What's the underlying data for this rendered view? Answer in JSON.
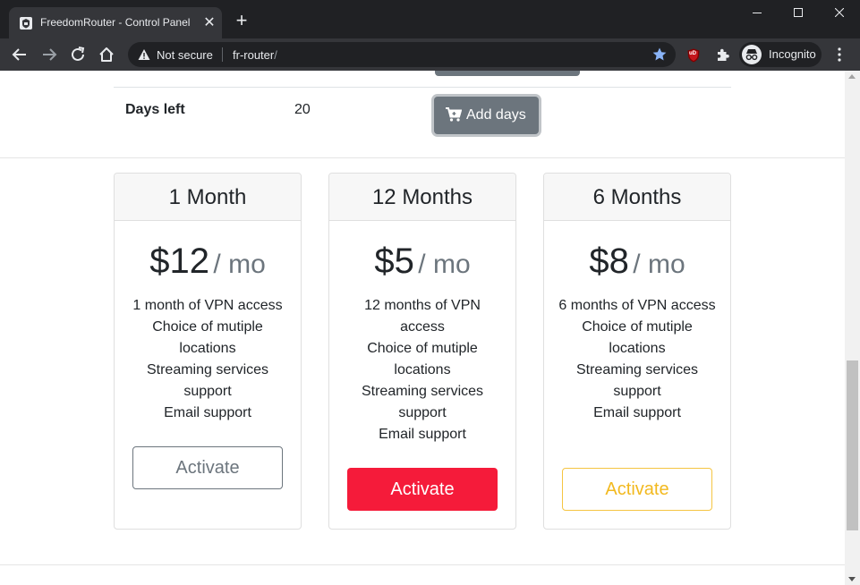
{
  "browser": {
    "tab_title": "FreedomRouter - Control Panel",
    "security_label": "Not secure",
    "url_host": "fr-router",
    "url_path": "/",
    "profile_label": "Incognito",
    "ublock_badge": "uD"
  },
  "page": {
    "days_left_label": "Days left",
    "days_left_value": "20",
    "add_days_label": "Add days"
  },
  "plans": [
    {
      "title": "1 Month",
      "price": "$12",
      "unit": "/ mo",
      "features": [
        "1 month of VPN access",
        "Choice of mutiple locations",
        "Streaming services support",
        "Email support"
      ],
      "button": "Activate",
      "style": "outline-secondary"
    },
    {
      "title": "12 Months",
      "price": "$5",
      "unit": "/ mo",
      "features": [
        "12 months of VPN access",
        "Choice of mutiple locations",
        "Streaming services support",
        "Email support"
      ],
      "button": "Activate",
      "style": "danger"
    },
    {
      "title": "6 Months",
      "price": "$8",
      "unit": "/ mo",
      "features": [
        "6 months of VPN access",
        "Choice of mutiple locations",
        "Streaming services support",
        "Email support"
      ],
      "button": "Activate",
      "style": "outline-warning"
    }
  ],
  "colors": {
    "danger": "#f51b3a",
    "warning": "#f5c542",
    "secondary": "#6c757d",
    "chrome_dark": "#202124",
    "chrome_toolbar": "#35363a",
    "star_blue": "#8ab4f8"
  }
}
